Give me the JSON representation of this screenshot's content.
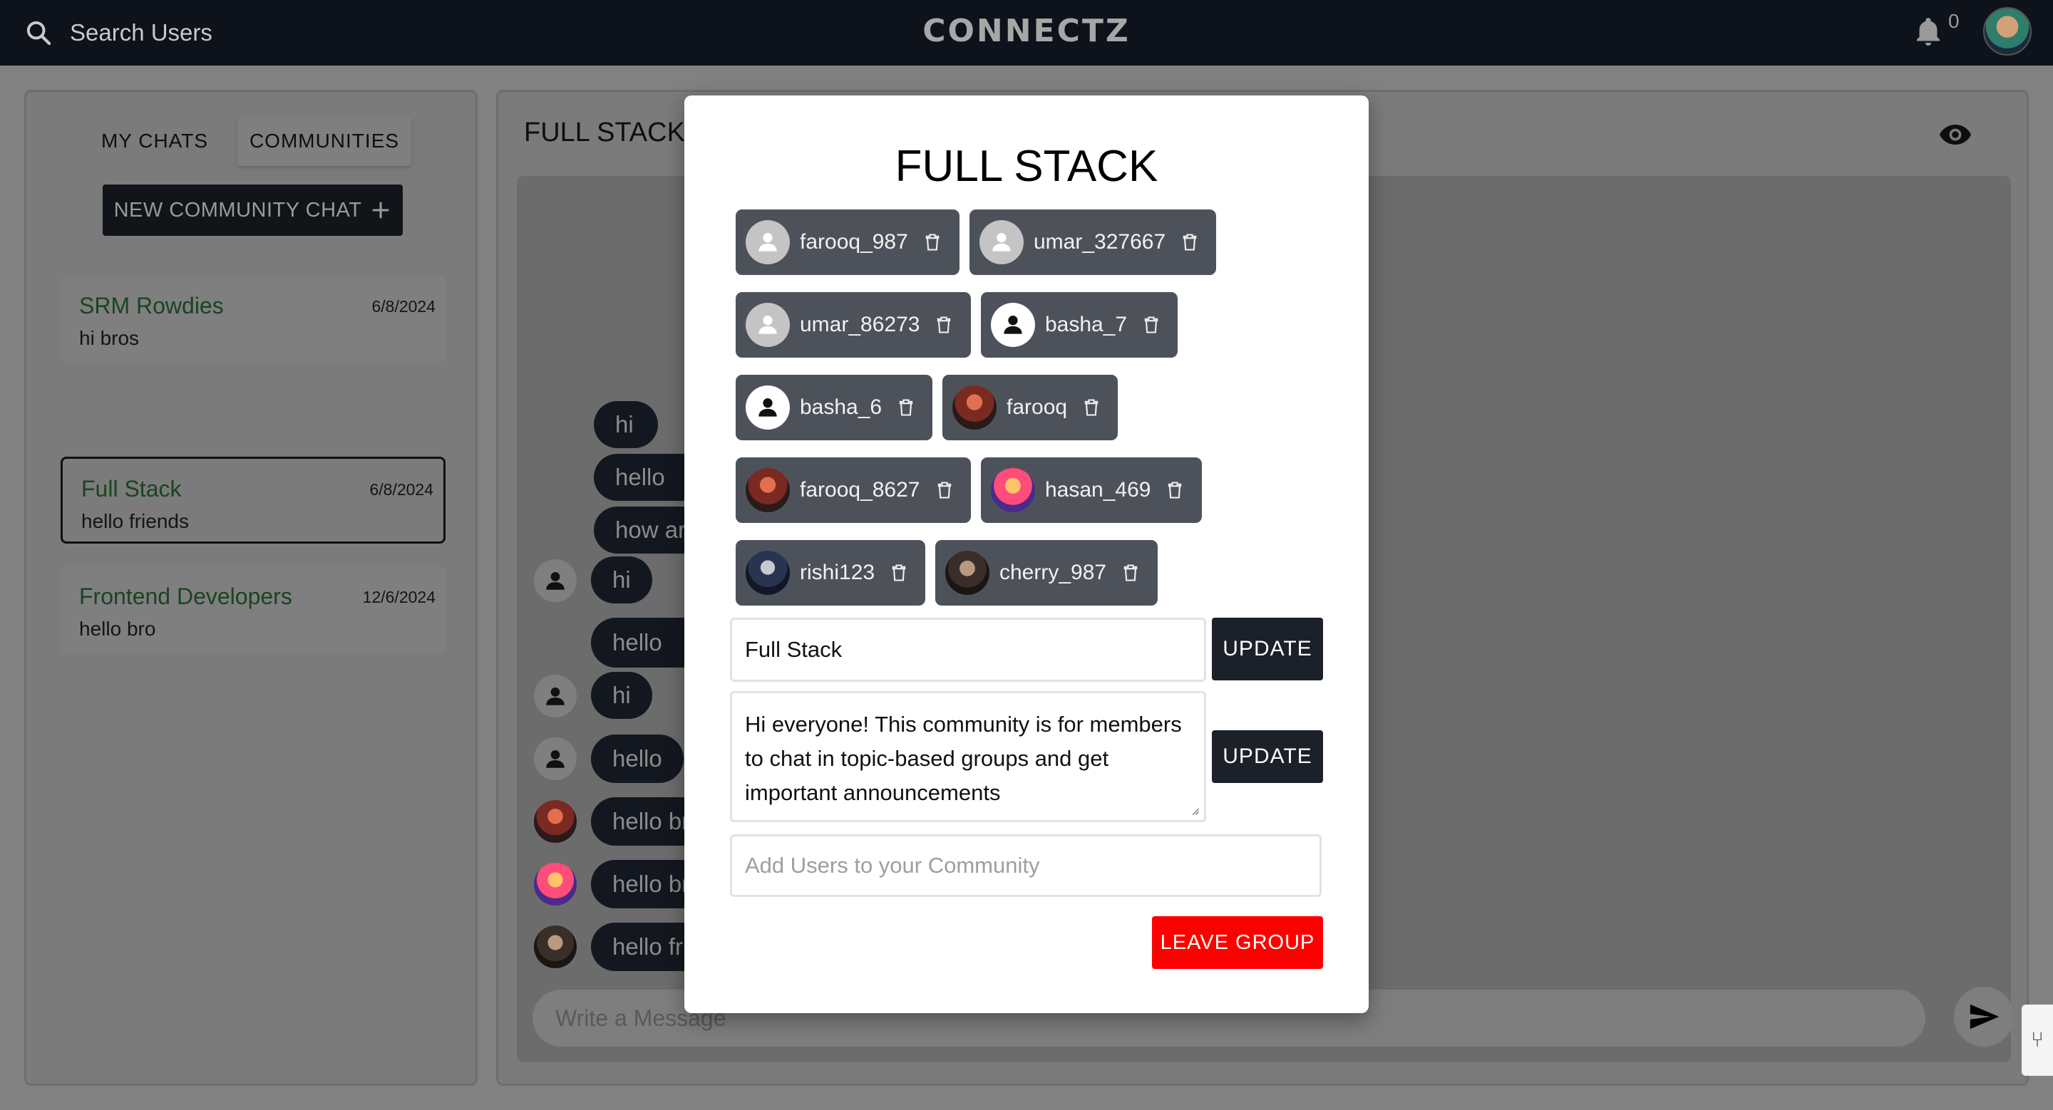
{
  "topbar": {
    "search_label": "Search Users",
    "brand": "CONNECTZ",
    "notification_count": "0"
  },
  "sidebar": {
    "tabs": [
      "MY CHATS",
      "COMMUNITIES"
    ],
    "new_button": "NEW COMMUNITY CHAT",
    "chats": [
      {
        "name": "SRM Rowdies",
        "last_message": "hi bros",
        "date": "6/8/2024"
      },
      {
        "name": "Full Stack",
        "last_message": "hello friends",
        "date": "6/8/2024"
      },
      {
        "name": "Frontend Developers",
        "last_message": "hello bro",
        "date": "12/6/2024"
      }
    ]
  },
  "main": {
    "title": "FULL STACK",
    "messages": [
      {
        "text": "hi"
      },
      {
        "text": "hello"
      },
      {
        "text": "how are"
      },
      {
        "text": "hi"
      },
      {
        "text": "hello"
      },
      {
        "text": "hi"
      },
      {
        "text": "hello"
      },
      {
        "text": "hello br"
      },
      {
        "text": "hello br"
      },
      {
        "text": "hello fri"
      }
    ],
    "input_placeholder": "Write a Message"
  },
  "modal": {
    "title": "FULL STACK",
    "members": [
      {
        "name": "farooq_987",
        "avatar": "default-grey"
      },
      {
        "name": "umar_327667",
        "avatar": "default-grey"
      },
      {
        "name": "umar_86273",
        "avatar": "default-grey"
      },
      {
        "name": "basha_7",
        "avatar": "default-white"
      },
      {
        "name": "basha_6",
        "avatar": "default-white"
      },
      {
        "name": "farooq",
        "avatar": "photo"
      },
      {
        "name": "farooq_8627",
        "avatar": "photo"
      },
      {
        "name": "hasan_469",
        "avatar": "photo"
      },
      {
        "name": "rishi123",
        "avatar": "photo"
      },
      {
        "name": "cherry_987",
        "avatar": "photo"
      }
    ],
    "name_value": "Full Stack",
    "update_label": "UPDATE",
    "description_value": "Hi everyone! This community is for members to chat in topic-based groups and get important announcements",
    "add_users_placeholder": "Add Users to your Community",
    "leave_label": "LEAVE GROUP"
  },
  "colors": {
    "topbar": "#0e121a",
    "chip": "#4d525a",
    "update_button": "#1c2028",
    "leave_button": "#ff0000",
    "chat_name": "#1a4422"
  }
}
